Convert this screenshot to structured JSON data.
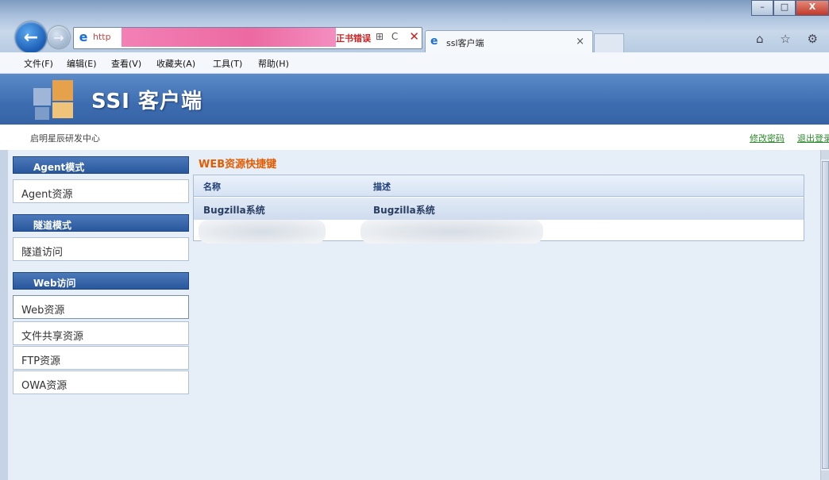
{
  "browser": {
    "address": {
      "url_text": "http",
      "cert_error": "正书错误",
      "controls": "⊞ C"
    },
    "tab": {
      "label": "ssl客户端"
    },
    "menu": [
      "文件(F)",
      "编辑(E)",
      "查看(V)",
      "收藏夹(A)",
      "工具(T)",
      "帮助(H)"
    ],
    "window_buttons": {
      "minimize": "–",
      "maximize": "□",
      "close": "X"
    },
    "right_icons": "⌂ ☆ ⚙"
  },
  "app": {
    "title": "SSI 客户端",
    "org": "启明星辰研发中心",
    "links": {
      "change_password": "修改密码",
      "logout": "退出登录"
    }
  },
  "sidebar": {
    "sections": [
      {
        "title": "Agent模式",
        "items": [
          "Agent资源"
        ]
      },
      {
        "title": "隧道模式",
        "items": [
          "隧道访问"
        ]
      },
      {
        "title": "Web访问",
        "items": [
          "Web资源",
          "文件共享资源",
          "FTP资源",
          "OWA资源"
        ]
      }
    ]
  },
  "content": {
    "title": "WEB资源快捷键",
    "columns": [
      "名称",
      "描述"
    ],
    "rows": [
      [
        "Bugzilla系统",
        "Bugzilla系统"
      ]
    ]
  },
  "colors": {
    "accent_orange": "#e35d00",
    "header_blue": "#3d6db0",
    "link_green": "#2a8a2a"
  }
}
